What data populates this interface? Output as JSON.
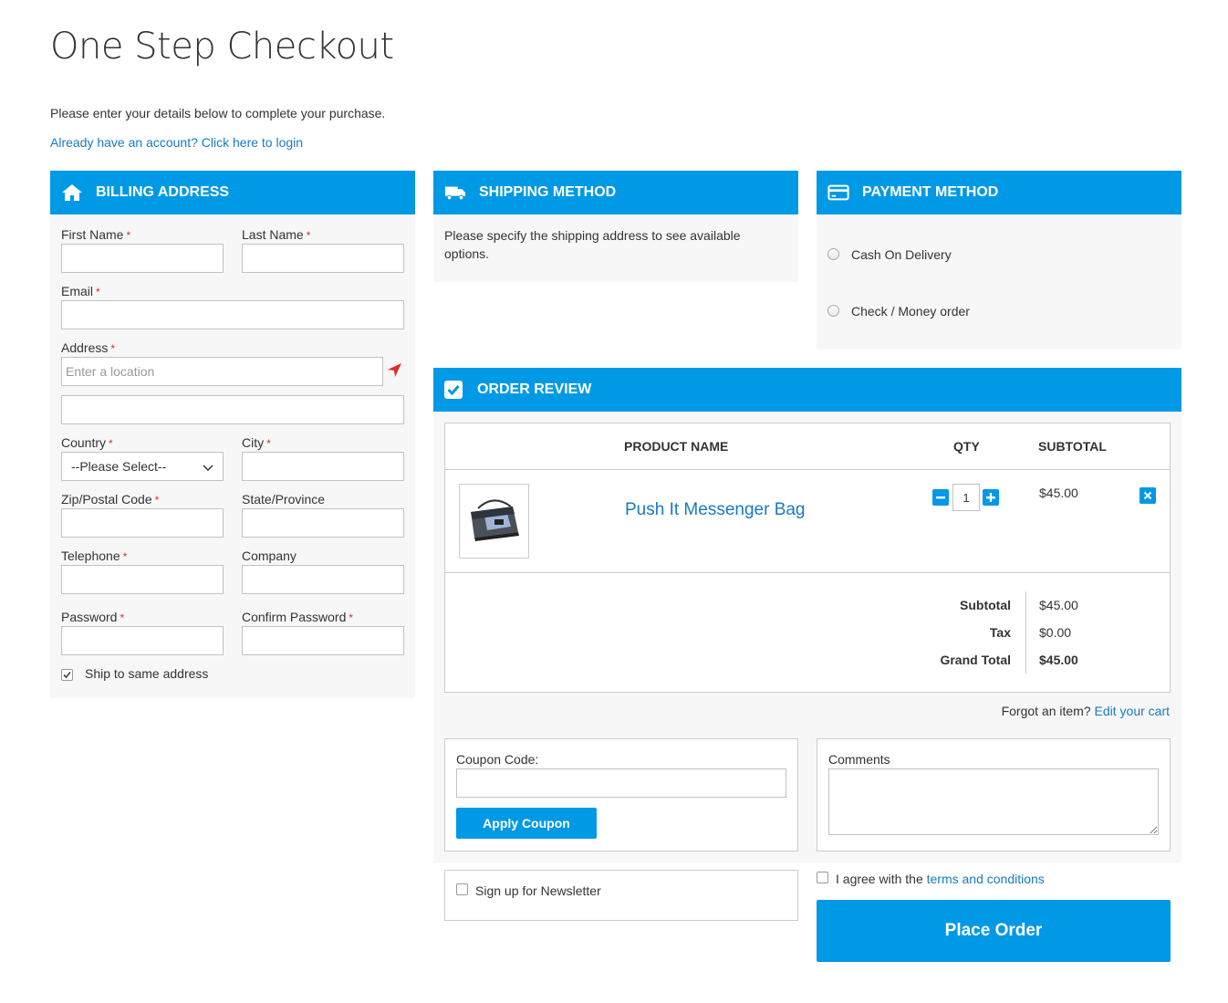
{
  "page": {
    "title": "One Step Checkout",
    "intro": "Please enter your details below to complete your purchase.",
    "login_link": "Already have an account? Click here to login"
  },
  "billing": {
    "heading": "Billing Address",
    "icon": "home-icon",
    "first_name_label": "First Name",
    "last_name_label": "Last Name",
    "email_label": "Email",
    "address_label": "Address",
    "address_placeholder": "Enter a location",
    "country_label": "Country",
    "country_value": "--Please Select--",
    "city_label": "City",
    "zip_label": "Zip/Postal Code",
    "state_label": "State/Province",
    "telephone_label": "Telephone",
    "company_label": "Company",
    "password_label": "Password",
    "confirm_password_label": "Confirm Password",
    "ship_same_label": "Ship to same address",
    "ship_same_checked": true,
    "required_mark": "*"
  },
  "shipping": {
    "heading": "Shipping Method",
    "icon": "truck-icon",
    "message": "Please specify the shipping address to see available options."
  },
  "payment": {
    "heading": "Payment Method",
    "icon": "credit-card-icon",
    "options": [
      "Cash On Delivery",
      "Check / Money order"
    ]
  },
  "review": {
    "heading": "Order Review",
    "icon": "checkbox-icon",
    "columns": [
      "Product Name",
      "Qty",
      "Subtotal"
    ],
    "item": {
      "name": "Push It Messenger Bag",
      "qty": "1",
      "subtotal": "$45.00"
    },
    "totals": {
      "subtotal_label": "Subtotal",
      "subtotal_value": "$45.00",
      "tax_label": "Tax",
      "tax_value": "$0.00",
      "grand_total_label": "Grand Total",
      "grand_total_value": "$45.00"
    },
    "forgot_text": "Forgot an item?",
    "edit_cart_link": "Edit your cart"
  },
  "coupon": {
    "label": "Coupon Code:",
    "button": "Apply Coupon"
  },
  "comments": {
    "label": "Comments"
  },
  "newsletter": {
    "label": "Sign up for Newsletter"
  },
  "terms": {
    "prefix": "I agree with the",
    "link": "terms and conditions"
  },
  "place_order": "Place Order",
  "colors": {
    "accent": "#0099e5",
    "link": "#1979c3",
    "required": "#e02b27",
    "panel_bg": "#f7f7f7"
  }
}
